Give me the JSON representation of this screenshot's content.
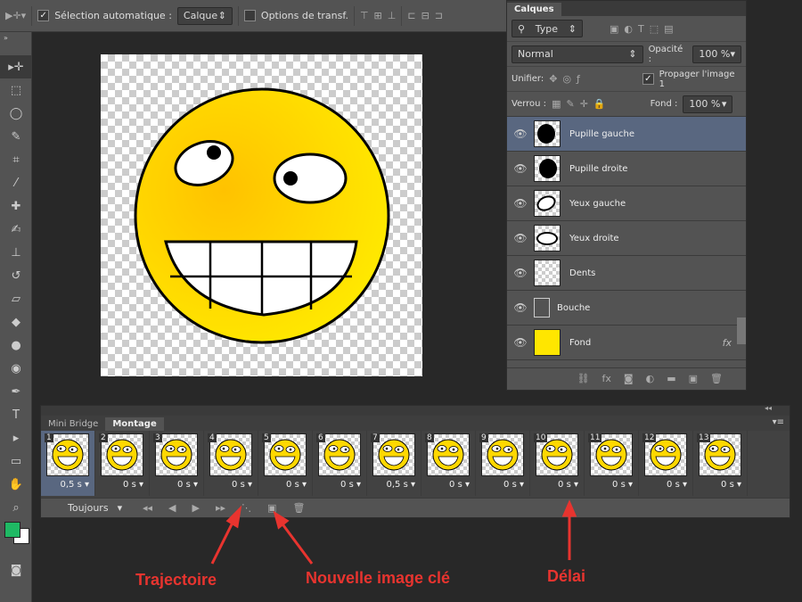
{
  "options_bar": {
    "auto_select_label": "Sélection automatique :",
    "auto_select_value": "Calque",
    "transform_label": "Options de transf."
  },
  "layers_panel": {
    "tab": "Calques",
    "filter": "Type",
    "blend_mode": "Normal",
    "opacity_label": "Opacité :",
    "opacity_value": "100 %",
    "unify_label": "Unifier:",
    "propagate_label": "Propager l'image 1",
    "lock_label": "Verrou :",
    "fill_label": "Fond :",
    "fill_value": "100 %",
    "layers": [
      {
        "name": "Pupille gauche",
        "selected": true
      },
      {
        "name": "Pupille droite"
      },
      {
        "name": "Yeux gauche"
      },
      {
        "name": "Yeux droite"
      },
      {
        "name": "Dents"
      },
      {
        "name": "Bouche"
      },
      {
        "name": "Fond",
        "fx": "fx"
      }
    ]
  },
  "timeline": {
    "tabs": [
      "Mini Bridge",
      "Montage"
    ],
    "frames": [
      {
        "num": "1",
        "delay": "0,5 s"
      },
      {
        "num": "2",
        "delay": "0 s"
      },
      {
        "num": "3",
        "delay": "0 s"
      },
      {
        "num": "4",
        "delay": "0 s"
      },
      {
        "num": "5",
        "delay": "0 s"
      },
      {
        "num": "6",
        "delay": "0 s"
      },
      {
        "num": "7",
        "delay": "0,5 s"
      },
      {
        "num": "8",
        "delay": "0 s"
      },
      {
        "num": "9",
        "delay": "0 s"
      },
      {
        "num": "10",
        "delay": "0 s"
      },
      {
        "num": "11",
        "delay": "0 s"
      },
      {
        "num": "12",
        "delay": "0 s"
      },
      {
        "num": "13",
        "delay": "0 s"
      }
    ],
    "loop": "Toujours"
  },
  "annotations": {
    "trajectoire": "Trajectoire",
    "new_frame": "Nouvelle image clé",
    "delay": "Délai"
  },
  "colors": {
    "annotation": "#e8342f",
    "foreground": "#1fb964",
    "background": "#ffffff",
    "smiley": "#ffd800"
  }
}
